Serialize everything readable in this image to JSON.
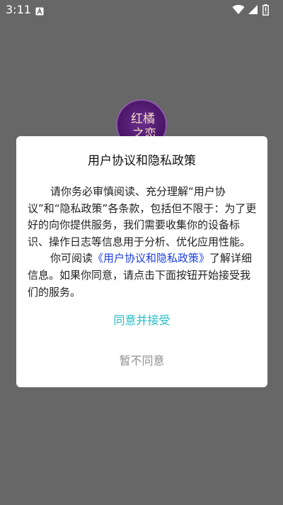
{
  "status_bar": {
    "time": "3:11",
    "notification_icon": "a-square-icon",
    "icons": [
      "wifi-icon",
      "cellular-signal-icon",
      "battery-icon"
    ]
  },
  "app": {
    "logo_text": [
      "红橘",
      "之恋"
    ],
    "logo_color": "#4a1568"
  },
  "dialog": {
    "title": "用户协议和隐私政策",
    "para1": "请你务必审慎阅读、充分理解“用户协议”和“隐私政策”各条款，包括但不限于：为了更好的向你提供服务，我们需要收集你的设备标识、操作日志等信息用于分析、优化应用性能。",
    "para2_prefix": "你可阅读",
    "para2_link": "《用户协议和隐私政策》",
    "para2_suffix": "了解详细信息。如果你同意，请点击下面按钮开始接受我们的服务。",
    "agree_label": "同意并接受",
    "disagree_label": "暂不同意"
  },
  "colors": {
    "overlay_background": "#676767",
    "link": "#1e3fe0",
    "agree": "#21bcc4",
    "disagree": "#8f8f8f"
  }
}
